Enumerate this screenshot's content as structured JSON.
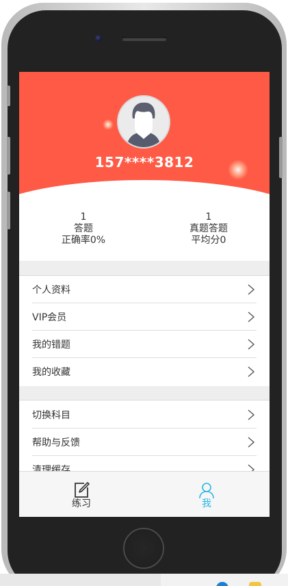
{
  "profile": {
    "username": "157****3812"
  },
  "stats": {
    "left": {
      "count": "1",
      "label": "答题",
      "sub": "正确率0%"
    },
    "right": {
      "count": "1",
      "label": "真题答题",
      "sub": "平均分0"
    }
  },
  "menu_group_1": [
    {
      "label": "个人资料"
    },
    {
      "label": "VIP会员"
    },
    {
      "label": "我的错题"
    },
    {
      "label": "我的收藏"
    }
  ],
  "menu_group_2": [
    {
      "label": "切换科目"
    },
    {
      "label": "帮助与反馈"
    },
    {
      "label": "清理缓存"
    }
  ],
  "tabbar": {
    "practice_label": "练习",
    "me_label": "我",
    "active_color": "#27b6e6"
  },
  "colors": {
    "header": "#ff5a45",
    "accent": "#27b6e6"
  },
  "icons": {
    "avatar": "user-avatar-icon",
    "chevron": "chevron-right-icon",
    "practice": "edit-icon",
    "me": "user-icon"
  }
}
